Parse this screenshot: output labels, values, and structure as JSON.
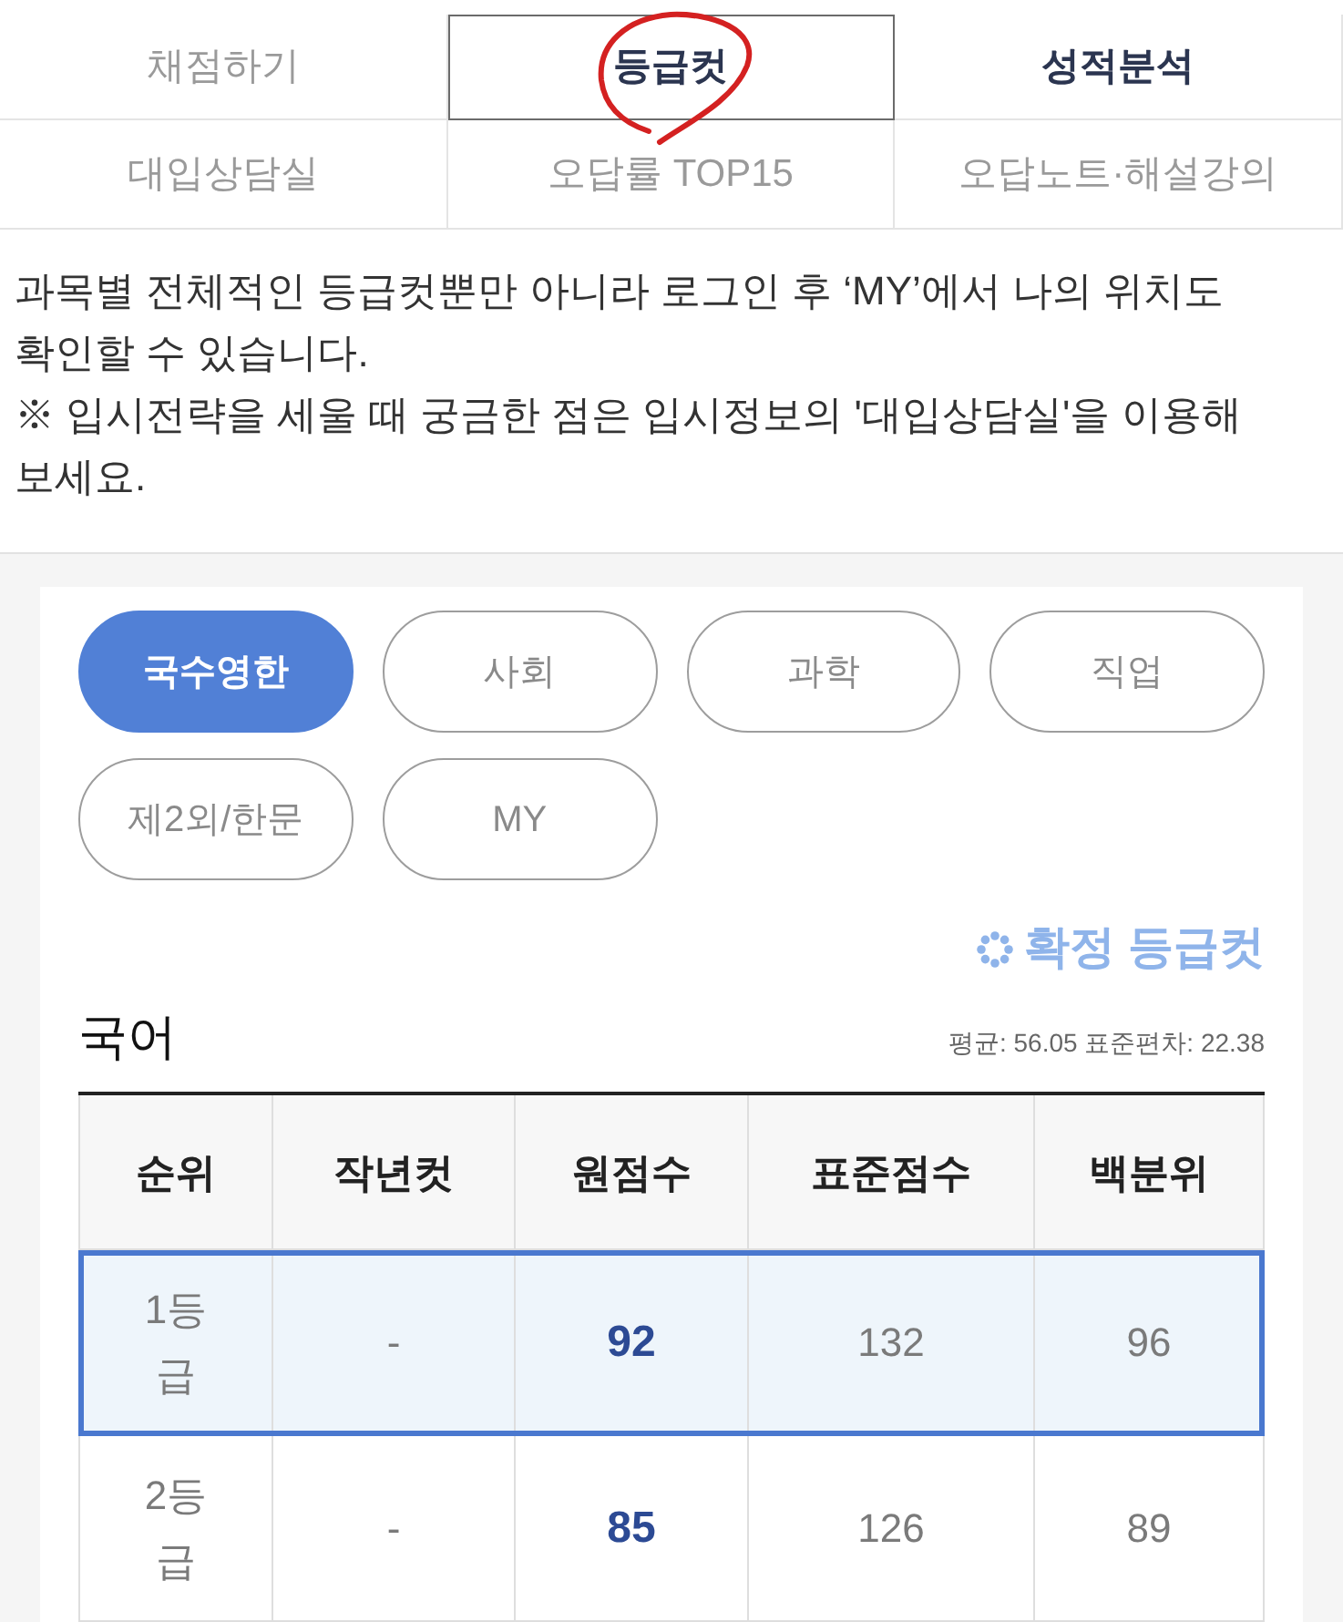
{
  "tabs": [
    {
      "label": "채점하기",
      "selected": false,
      "emphasized": false,
      "circled": false
    },
    {
      "label": "등급컷",
      "selected": true,
      "emphasized": true,
      "circled": true
    },
    {
      "label": "성적분석",
      "selected": false,
      "emphasized": true,
      "circled": false
    },
    {
      "label": "대입상담실",
      "selected": false,
      "emphasized": false,
      "circled": false
    },
    {
      "label": "오답률 TOP15",
      "selected": false,
      "emphasized": false,
      "circled": false
    },
    {
      "label": "오답노트·해설강의",
      "selected": false,
      "emphasized": false,
      "circled": false
    }
  ],
  "notice": [
    "과목별 전체적인 등급컷뿐만 아니라 로그인 후 ‘MY’에서 나의 위치도 확인할 수 있습니다.",
    "※ 입시전략을 세울 때 궁금한 점은 입시정보의 '대입상담실'을 이용해 보세요."
  ],
  "subject_tabs": [
    {
      "label": "국수영한",
      "selected": true
    },
    {
      "label": "사회",
      "selected": false
    },
    {
      "label": "과학",
      "selected": false
    },
    {
      "label": "직업",
      "selected": false
    },
    {
      "label": "제2외/한문",
      "selected": false
    },
    {
      "label": "MY",
      "selected": false
    }
  ],
  "confirmed_link": {
    "label": "확정 등급컷"
  },
  "subject": {
    "title": "국어",
    "stats": "평균: 56.05 표준편차: 22.38"
  },
  "table": {
    "columns": [
      {
        "label": "순위",
        "emphasized": false
      },
      {
        "label": "작년컷",
        "emphasized": false
      },
      {
        "label": "원점수",
        "emphasized": true
      },
      {
        "label": "표준점수",
        "emphasized": false
      },
      {
        "label": "백분위",
        "emphasized": false
      }
    ],
    "rows": [
      {
        "cells": [
          "1등급",
          "-",
          "92",
          "132",
          "96"
        ],
        "selected": true
      },
      {
        "cells": [
          "2등급",
          "-",
          "85",
          "126",
          "89"
        ],
        "selected": false
      }
    ]
  }
}
